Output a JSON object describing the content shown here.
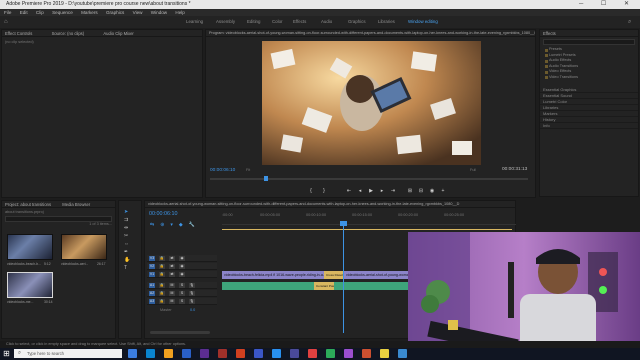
{
  "window": {
    "title": "Adobe Premiere Pro 2019 - D:\\youtube\\premiere pro course new\\about transitions *",
    "controls": "─ ☐ ✕"
  },
  "menu": [
    "File",
    "Edit",
    "Clip",
    "Sequence",
    "Markers",
    "Graphics",
    "View",
    "Window",
    "Help"
  ],
  "workspaces": [
    {
      "label": "Learning",
      "active": false
    },
    {
      "label": "Assembly",
      "active": false
    },
    {
      "label": "Editing",
      "active": false
    },
    {
      "label": "Color",
      "active": false
    },
    {
      "label": "Effects",
      "active": false
    },
    {
      "label": "Audio",
      "active": false
    },
    {
      "label": "Graphics",
      "active": false
    },
    {
      "label": "Libraries",
      "active": false
    },
    {
      "label": "Window editing",
      "active": true
    }
  ],
  "source_panel": {
    "tab1": "Effect Controls",
    "tab2": "Source: (no clips)",
    "tab3": "Audio Clip Mixer",
    "empty_text": "(no clip selected)"
  },
  "program_panel": {
    "title": "Program: videoblocks-aerial-shot-of-young-woman-sitting-on-floor-surrounded-with-different-papers-and-documents-with-laptop-on-her-knees-and-working-in-the-late-evening_rgxmbkbs_1080__D",
    "timecode_left": "00:00:06:10",
    "zoom": "Fit",
    "quality": "Full",
    "timecode_right": "00:00:31:13"
  },
  "project_panel": {
    "tab": "Project: about transitions",
    "tab2": "Media Browser",
    "filename": "about transitions.prproj",
    "items_count": "1 of 3 items...",
    "clips": [
      {
        "name": "videoblocks-beach-b...",
        "duration": "5:12"
      },
      {
        "name": "videoblocks-aeri...",
        "duration": "26:17"
      },
      {
        "name": "videoblocks-me...",
        "duration": "30:14"
      }
    ]
  },
  "timeline_panel": {
    "sequence_name": "videoblocks-aerial-shot-of-young-woman-sitting-on-floor-surrounded-with-different-papers-and-documents-with-laptop-on-her-knees-and-working-in-the-late-evening_rgxmbkbs_1080__D",
    "timecode": "00:00:06:10",
    "ruler_labels": [
      ":00:00",
      "00:00:05:00",
      "00:00:10:00",
      "00:00:15:00",
      "00:00:20:00",
      "00:00:25:00"
    ],
    "tracks": [
      "V3",
      "V2",
      "V1",
      "A1",
      "A2",
      "A3"
    ],
    "master_label": "Master",
    "master_value": "0.0",
    "clips": {
      "v1_a": "videoblocks-beach-felicia-mp4 fl 1016-wave-people-riding-in-a-big...",
      "v1_transition": "Cross Dissolve",
      "v1_b": "videoblocks-aerial-shot-of-young-woman-sitting-on-floor-surrounded-with-diff...",
      "a1_transition": "Constant Power"
    }
  },
  "effects_panel": {
    "tab": "Effects",
    "search_placeholder": "",
    "folders": [
      "Presets",
      "Lumetri Presets",
      "Audio Effects",
      "Audio Transitions",
      "Video Effects",
      "Video Transitions"
    ],
    "sections": [
      "Essential Graphics",
      "Essential Sound",
      "Lumetri Color",
      "Libraries",
      "Markers",
      "History",
      "Info"
    ]
  },
  "status_bar": {
    "text": "Click to select, or click in empty space and drag to marquee select. Use Shift, Alt, and Ctrl for other options."
  },
  "taskbar": {
    "search_placeholder": "Type here to search",
    "colors": [
      "#3b7de0",
      "#0a84d0",
      "#f0a020",
      "#2a60c8",
      "#5c2d91",
      "#a0302a",
      "#d04020",
      "#3a56c8",
      "#2890f0",
      "#4a4a9a",
      "#e04040",
      "#2caa5a",
      "#9b4fd0",
      "#cc5030",
      "#e8d040",
      "#3a8ad0"
    ]
  },
  "colors": {
    "accent": "#3d93e4",
    "clip_purple": "#8b84c9",
    "clip_audio": "#3ea57b",
    "transition": "#d8b760"
  }
}
